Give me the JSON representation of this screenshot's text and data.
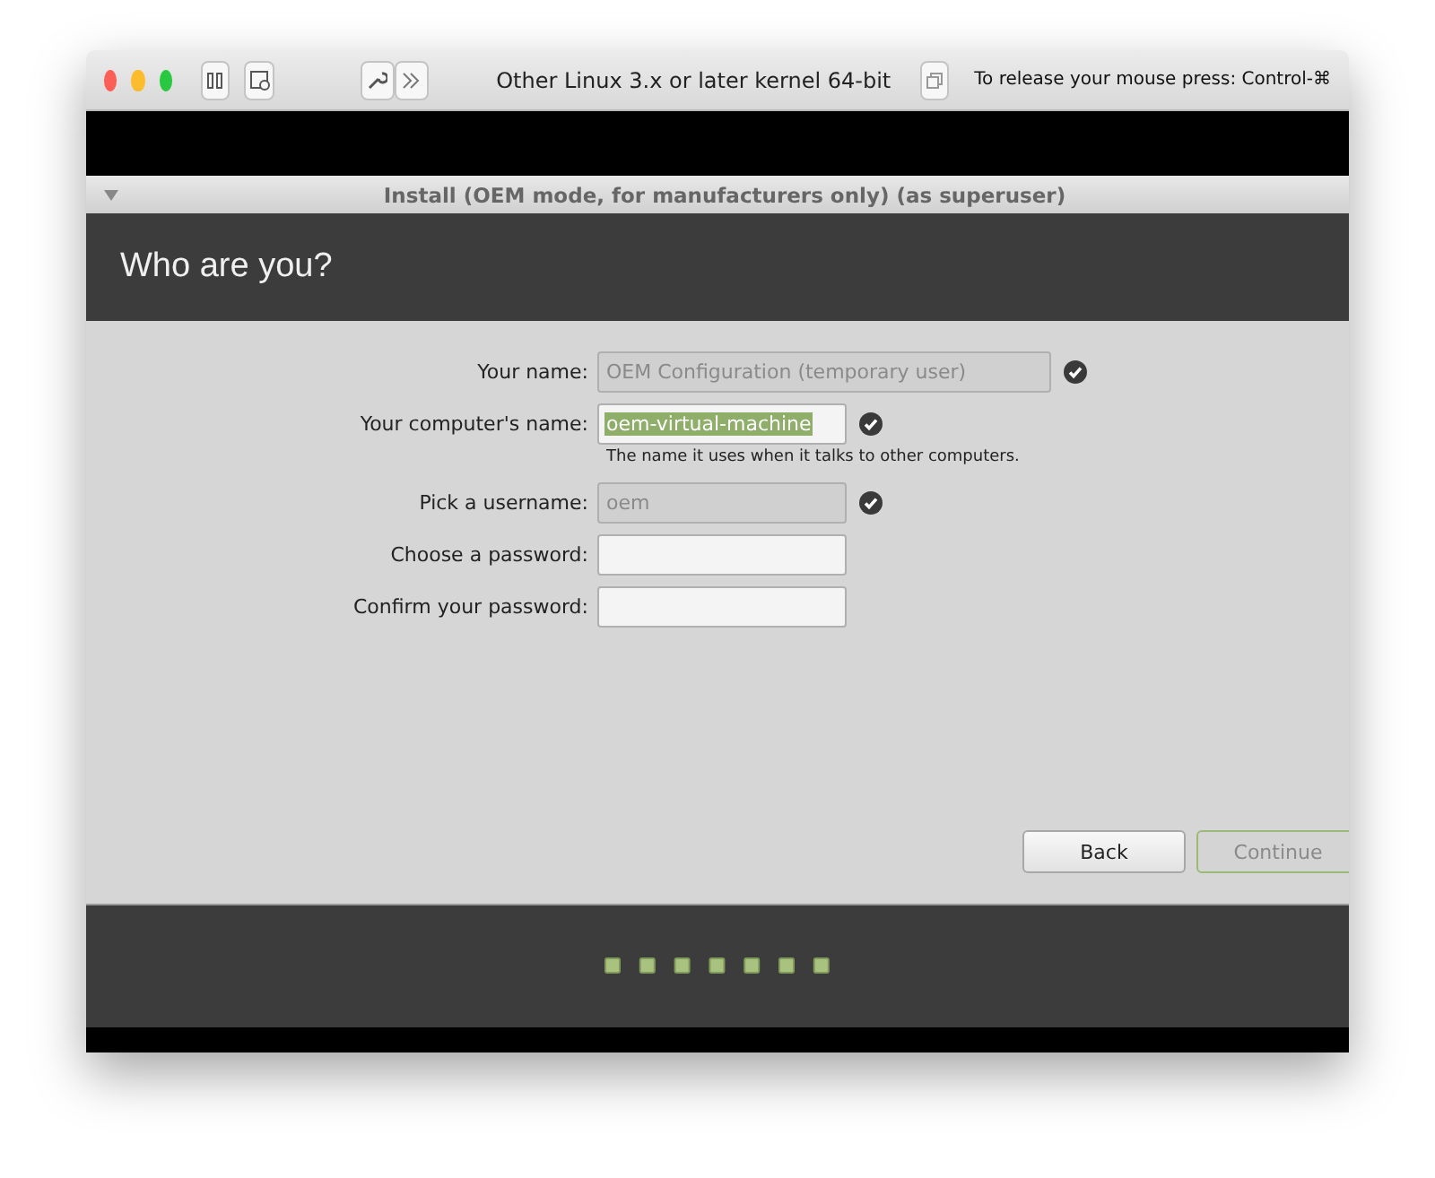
{
  "window": {
    "title": "Other Linux 3.x or later kernel 64-bit",
    "hint": "To release your mouse press: Control-⌘"
  },
  "installer": {
    "title": "Install (OEM mode, for manufacturers only) (as superuser)",
    "heading": "Who are you?"
  },
  "fields": [
    {
      "label": "Your name:",
      "value": "OEM Configuration (temporary user)",
      "disabled": true,
      "valid": true,
      "highlighted": false
    },
    {
      "label": "Your computer's name:",
      "value": "oem-virtual-machine",
      "disabled": false,
      "valid": true,
      "highlighted": true,
      "hint": "The name it uses when it talks to other computers."
    },
    {
      "label": "Pick a username:",
      "value": "oem",
      "disabled": true,
      "valid": true,
      "highlighted": false
    },
    {
      "label": "Choose a password:",
      "disabled": false,
      "valid": false
    },
    {
      "label": "Confirm your password:",
      "disabled": false,
      "valid": false
    }
  ],
  "buttons": [
    {
      "label": "Back",
      "disabled": false
    },
    {
      "label": "Continue",
      "disabled": true
    }
  ]
}
